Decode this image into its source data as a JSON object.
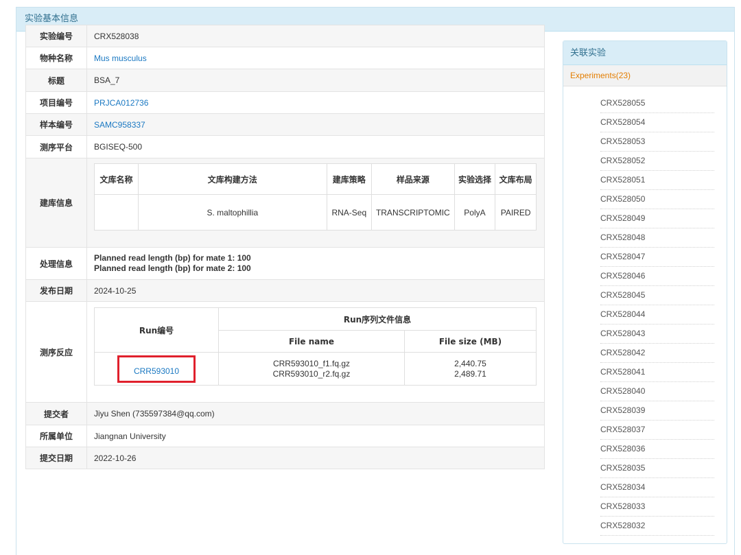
{
  "panel": {
    "title": "实验基本信息"
  },
  "info": {
    "exp_id": {
      "label": "实验编号",
      "value": "CRX528038"
    },
    "species": {
      "label": "物种名称",
      "value": "Mus musculus"
    },
    "title": {
      "label": "标题",
      "value": "BSA_7"
    },
    "project": {
      "label": "项目编号",
      "value": "PRJCA012736"
    },
    "sample": {
      "label": "样本编号",
      "value": "SAMC958337"
    },
    "platform": {
      "label": "测序平台",
      "value": "BGISEQ-500"
    },
    "library": {
      "label": "建库信息",
      "headers": [
        "文库名称",
        "文库构建方法",
        "建库策略",
        "样品来源",
        "实验选择",
        "文库布局"
      ],
      "row": [
        "",
        "S. maltophillia",
        "RNA-Seq",
        "TRANSCRIPTOMIC",
        "PolyA",
        "PAIRED"
      ]
    },
    "processing": {
      "label": "处理信息",
      "line1": "Planned read length (bp) for mate 1: 100",
      "line2": "Planned read length (bp) for mate 2: 100"
    },
    "release": {
      "label": "发布日期",
      "value": "2024-10-25"
    },
    "runs": {
      "label": "测序反应",
      "run_header": "Run编号",
      "file_info_header": "Run序列文件信息",
      "file_name_header": "File name",
      "file_size_header": "File size (MB)",
      "run_id": "CRR593010",
      "file1": "CRR593010_f1.fq.gz",
      "file2": "CRR593010_r2.fq.gz",
      "size1": "2,440.75",
      "size2": "2,489.71"
    },
    "submitter": {
      "label": "提交者",
      "value": "Jiyu Shen (735597384@qq.com)"
    },
    "organization": {
      "label": "所属单位",
      "value": "Jiangnan University"
    },
    "submit_date": {
      "label": "提交日期",
      "value": "2022-10-26"
    }
  },
  "sidebar": {
    "title": "关联实验",
    "subtitle": "Experiments(23)",
    "items": [
      "CRX528055",
      "CRX528054",
      "CRX528053",
      "CRX528052",
      "CRX528051",
      "CRX528050",
      "CRX528049",
      "CRX528048",
      "CRX528047",
      "CRX528046",
      "CRX528045",
      "CRX528044",
      "CRX528043",
      "CRX528042",
      "CRX528041",
      "CRX528040",
      "CRX528039",
      "CRX528037",
      "CRX528036",
      "CRX528035",
      "CRX528034",
      "CRX528033",
      "CRX528032"
    ]
  },
  "colors": {
    "link": "#1a78c2",
    "highlight_border": "#e0202c",
    "panel_header": "#d9edf7",
    "sidebar_subtitle": "#e37d00"
  }
}
